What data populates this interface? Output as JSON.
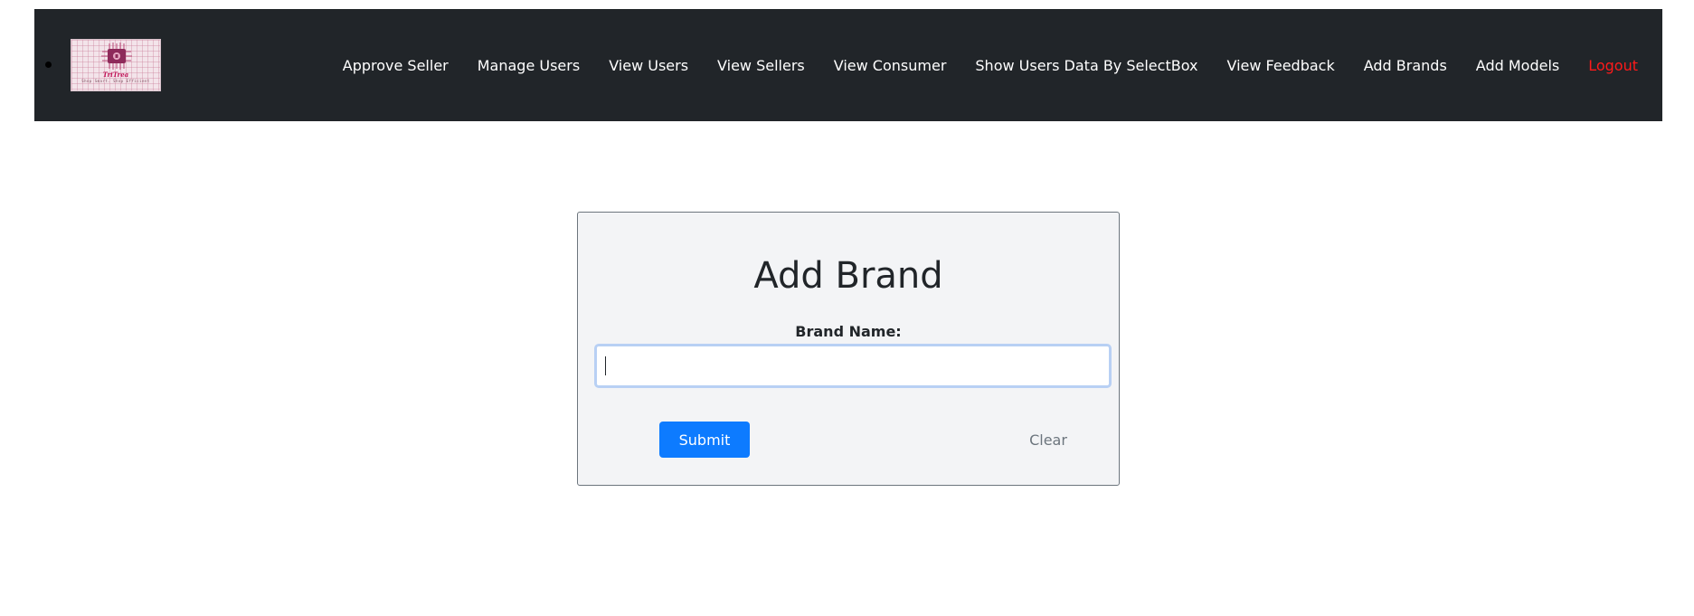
{
  "navbar": {
    "logo": {
      "name": "TriTrea",
      "tagline": "Shop Smart. Shop Efficient"
    },
    "links": [
      {
        "label": "Approve Seller"
      },
      {
        "label": "Manage Users"
      },
      {
        "label": "View Users"
      },
      {
        "label": "View Sellers"
      },
      {
        "label": "View Consumer"
      },
      {
        "label": "Show Users Data By SelectBox"
      },
      {
        "label": "View Feedback"
      },
      {
        "label": "Add Brands"
      },
      {
        "label": "Add Models"
      },
      {
        "label": "Logout"
      }
    ],
    "colors": {
      "background": "#212529",
      "link": "#ffffff",
      "logout": "#ff1a1a"
    }
  },
  "form": {
    "title": "Add Brand",
    "brand_label": "Brand Name:",
    "brand_value": "",
    "submit_label": "Submit",
    "clear_label": "Clear",
    "colors": {
      "submit": "#0d7bff",
      "card_background": "#f3f4f6",
      "input_focus_border": "#b8d0f4"
    }
  }
}
